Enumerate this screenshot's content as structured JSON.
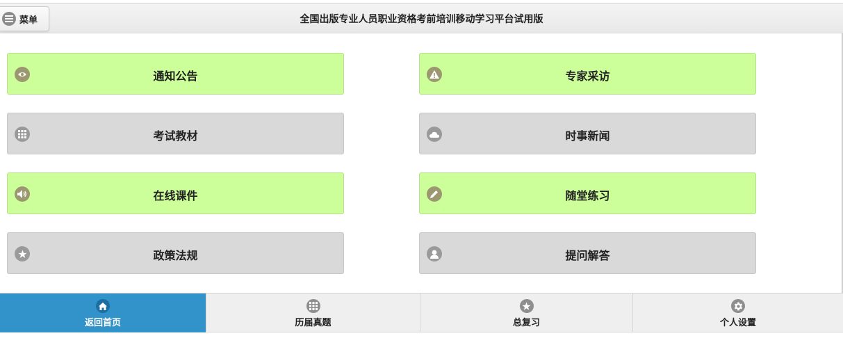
{
  "header": {
    "menu_label": "菜单",
    "menu_icon": "hamburger-icon",
    "title": "全国出版专业人员职业资格考前培训移动学习平台试用版"
  },
  "tiles": [
    {
      "label": "通知公告",
      "icon": "eye-icon",
      "style": "green"
    },
    {
      "label": "专家采访",
      "icon": "warning-icon",
      "style": "green"
    },
    {
      "label": "考试教材",
      "icon": "grid-icon",
      "style": "gray"
    },
    {
      "label": "时事新闻",
      "icon": "cloud-icon",
      "style": "gray"
    },
    {
      "label": "在线课件",
      "icon": "audio-icon",
      "style": "green"
    },
    {
      "label": "随堂练习",
      "icon": "pencil-icon",
      "style": "green"
    },
    {
      "label": "政策法规",
      "icon": "star-icon",
      "style": "gray"
    },
    {
      "label": "提问解答",
      "icon": "user-icon",
      "style": "gray"
    }
  ],
  "bottom_nav": [
    {
      "label": "返回首页",
      "icon": "home-icon",
      "active": true
    },
    {
      "label": "历届真题",
      "icon": "grid-icon",
      "active": false
    },
    {
      "label": "总复习",
      "icon": "star-icon",
      "active": false
    },
    {
      "label": "个人设置",
      "icon": "gear-icon",
      "active": false
    }
  ],
  "colors": {
    "tile_green": "#ccff99",
    "tile_gray": "#d9d9d9",
    "nav_active": "#3193c9"
  }
}
